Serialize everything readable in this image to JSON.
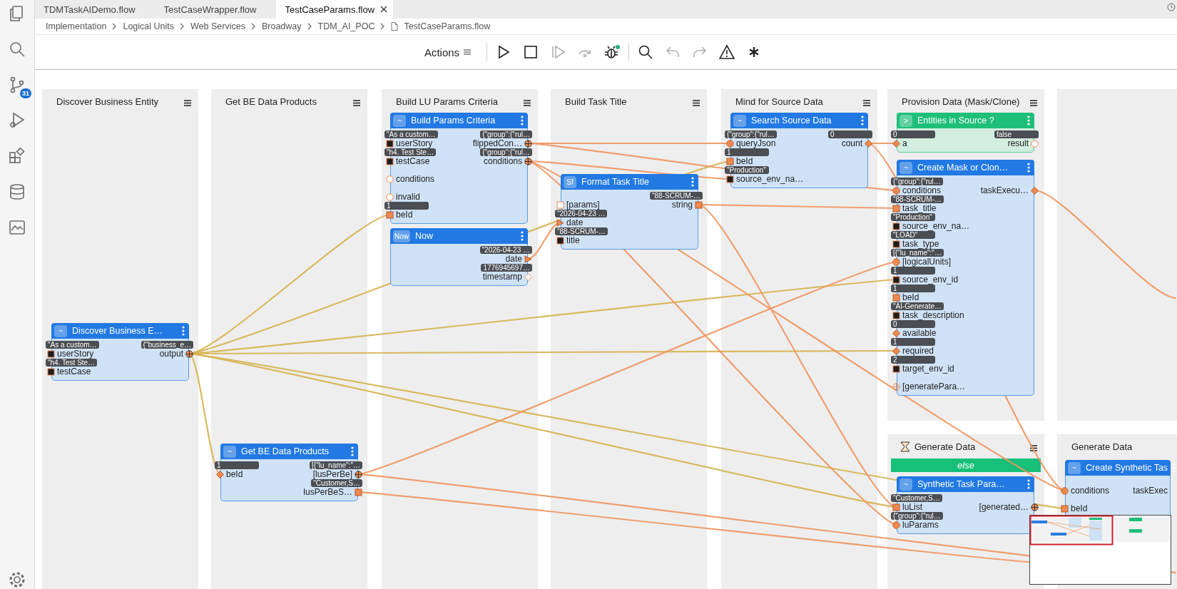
{
  "activity_bar": [
    {
      "kind": "files"
    },
    {
      "kind": "search"
    },
    {
      "kind": "source-control",
      "badge": "31"
    },
    {
      "kind": "run-debug"
    },
    {
      "kind": "extensions"
    },
    {
      "kind": "database"
    },
    {
      "kind": "monitor"
    },
    {
      "kind": "settings"
    }
  ],
  "tabs": [
    {
      "label": "TDMTaskAIDemo.flow",
      "selected": false
    },
    {
      "label": "TestCaseWrapper.flow",
      "selected": false
    },
    {
      "label": "TestCaseParams.flow",
      "selected": true
    }
  ],
  "breadcrumb": [
    {
      "label": "Implementation",
      "kind": "folder"
    },
    {
      "label": "Logical Units",
      "kind": "folder"
    },
    {
      "label": "Web Services",
      "kind": "folder"
    },
    {
      "label": "Broadway",
      "kind": "folder"
    },
    {
      "label": "TDM_AI_POC",
      "kind": "folder"
    },
    {
      "label": "TestCaseParams.flow",
      "kind": "file"
    }
  ],
  "toolbar": {
    "actions_label": "Actions",
    "groups": [
      [
        {
          "kind": "play",
          "disabled": false,
          "indicator": false
        },
        {
          "kind": "stop",
          "disabled": false,
          "indicator": false
        },
        {
          "kind": "step",
          "disabled": true,
          "indicator": false
        },
        {
          "kind": "step-over",
          "disabled": true,
          "indicator": false
        },
        {
          "kind": "debug",
          "disabled": false,
          "indicator": true
        }
      ],
      [
        {
          "kind": "search",
          "disabled": false,
          "indicator": false
        },
        {
          "kind": "undo",
          "disabled": true,
          "indicator": false
        },
        {
          "kind": "redo",
          "disabled": true,
          "indicator": false
        },
        {
          "kind": "warning",
          "disabled": false,
          "indicator": false
        },
        {
          "kind": "asterisk",
          "disabled": false,
          "indicator": false
        }
      ]
    ]
  },
  "lanes": [
    {
      "kind": "stage",
      "title": "Discover Business Entity",
      "menu": true
    },
    {
      "kind": "stage",
      "title": "Get BE Data Products",
      "menu": true
    },
    {
      "kind": "stage",
      "title": "Build LU Params Criteria",
      "menu": true
    },
    {
      "kind": "stage",
      "title": "Build Task Title",
      "menu": true
    },
    {
      "kind": "stage",
      "title": "Mind for Source Data",
      "menu": true
    },
    {
      "kind": "stage",
      "title": "Provision Data (Mask/Clone)",
      "menu": true
    },
    {
      "kind": "stage",
      "menu": false
    },
    {
      "kind": "timer",
      "title": "Generate Data",
      "menu": true,
      "branch": "else"
    },
    {
      "kind": "stage",
      "title": "Generate Data",
      "menu": false
    }
  ],
  "nodes": [
    {
      "kind": "actor",
      "icon_label": "~",
      "title": "Discover Business E…",
      "left_ports": [
        {
          "label": "userStory",
          "badge": "\"As a custom…",
          "kind": "square-dark"
        },
        {
          "label": "testCase",
          "badge": "\"h4. Test Ste…",
          "kind": "square-dark"
        }
      ],
      "right_ports": [
        {
          "label": "output",
          "badge": "{\"business_e…",
          "kind": "plus"
        }
      ]
    },
    {
      "kind": "actor",
      "icon_label": "~",
      "title": "Build Params Criteria",
      "left_ports": [
        {
          "label": "userStory",
          "badge": "\"As a custom…",
          "kind": "square-dark"
        },
        {
          "label": "testCase",
          "badge": "\"h4. Test Ste…",
          "kind": "square-dark"
        },
        {
          "label": "conditions",
          "kind": "circle-open"
        },
        {
          "label": "invalid",
          "kind": "circle-open"
        },
        {
          "label": "beId",
          "badge": "1",
          "kind": "square"
        }
      ],
      "right_ports": [
        {
          "label": "flippedCon…",
          "badge": "{\"group\":{\"rul…",
          "kind": "plus"
        },
        {
          "label": "conditions",
          "badge": "{\"group\":{\"rul…",
          "kind": "plus"
        }
      ]
    },
    {
      "kind": "actor",
      "icon_label": "Now",
      "title": "Now",
      "right_ports": [
        {
          "label": "date",
          "badge": "\"2026-04-23 …",
          "kind": "triangle"
        },
        {
          "label": "timestamp",
          "badge": "1776945697…",
          "kind": "diamond-open"
        }
      ]
    },
    {
      "kind": "actor",
      "icon_label": "Sf",
      "title": "Format Task Title",
      "left_ports": [
        {
          "label": "[params]",
          "kind": "square-open"
        },
        {
          "label": "date",
          "badge": "\"2026-04-23 …",
          "kind": "triangle"
        },
        {
          "label": "title",
          "badge": "\"88-SCRUM-…",
          "kind": "square-dark"
        }
      ],
      "right_ports": [
        {
          "label": "string",
          "badge": "\"88-SCRUM-…",
          "kind": "square"
        }
      ]
    },
    {
      "kind": "actor",
      "icon_label": "~",
      "title": "Search Source Data",
      "left_ports": [
        {
          "label": "queryJson",
          "badge": "{\"group\":{\"rul…",
          "kind": "circle"
        },
        {
          "label": "beId",
          "badge": "1",
          "kind": "square"
        },
        {
          "label": "source_env_na…",
          "badge": "\"Production\"",
          "kind": "square-dark"
        }
      ],
      "right_ports": [
        {
          "label": "count",
          "badge": "0",
          "kind": "diamond"
        }
      ]
    },
    {
      "kind": "condition",
      "icon_label": ">",
      "title": "Entities in Source ?",
      "left_ports": [
        {
          "label": "a",
          "badge": "0",
          "kind": "diamond"
        }
      ],
      "right_ports": [
        {
          "label": "result",
          "badge": "false",
          "kind": "circle-open"
        }
      ]
    },
    {
      "kind": "actor",
      "icon_label": "~",
      "title": "Create Mask or Clon…",
      "left_ports": [
        {
          "label": "conditions",
          "badge": "{\"group\":{\"rul…",
          "kind": "circle"
        },
        {
          "label": "task_title",
          "badge": "\"88-SCRUM-…",
          "kind": "square"
        },
        {
          "label": "source_env_na…",
          "badge": "\"Production\"",
          "kind": "square-dark"
        },
        {
          "label": "task_type",
          "badge": "\"LOAD\"",
          "kind": "square-dark"
        },
        {
          "label": "[logicalUnits]",
          "badge": "[{\"lu_name\":\"…",
          "kind": "circle"
        },
        {
          "label": "source_env_id",
          "badge": "1",
          "kind": "square-dark"
        },
        {
          "label": "beId",
          "badge": "1",
          "kind": "square"
        },
        {
          "label": "task_description",
          "badge": "\"AI-Generate…",
          "kind": "square-dark"
        },
        {
          "label": "available",
          "badge": "0",
          "kind": "diamond"
        },
        {
          "label": "required",
          "badge": "1",
          "kind": "diamond"
        },
        {
          "label": "target_env_id",
          "badge": "2",
          "kind": "square-dark"
        },
        {
          "label": "[generatePara…",
          "kind": "plus-open"
        }
      ],
      "right_ports": [
        {
          "label": "taskExecu…",
          "kind": "diamond"
        }
      ]
    },
    {
      "kind": "actor",
      "icon_label": "~",
      "title": "Get BE Data Products",
      "left_ports": [
        {
          "label": "beId",
          "badge": "1",
          "kind": "diamond"
        }
      ],
      "right_ports": [
        {
          "label": "[lusPerBe]",
          "badge": "[{\"lu_name\":\"…",
          "kind": "plus"
        },
        {
          "label": "lusPerBeS…",
          "badge": "\"Customer,S…",
          "kind": "square"
        }
      ]
    },
    {
      "kind": "actor",
      "icon_label": "~",
      "title": "Synthetic Task Para…",
      "left_ports": [
        {
          "label": "luList",
          "badge": "\"Customer,S…",
          "kind": "square"
        },
        {
          "label": "luParams",
          "badge": "{\"group\":{\"rul…",
          "kind": "circle"
        }
      ],
      "right_ports": [
        {
          "label": "[generated…",
          "kind": "plus"
        }
      ]
    },
    {
      "kind": "actor",
      "icon_label": "~",
      "title": "Create Synthetic Tas",
      "left_ports": [
        {
          "label": "conditions",
          "kind": "circle"
        },
        {
          "label": "beId",
          "kind": "square"
        }
      ],
      "right_ports": [
        {
          "label": "taskExec",
          "kind": "none"
        }
      ]
    }
  ]
}
